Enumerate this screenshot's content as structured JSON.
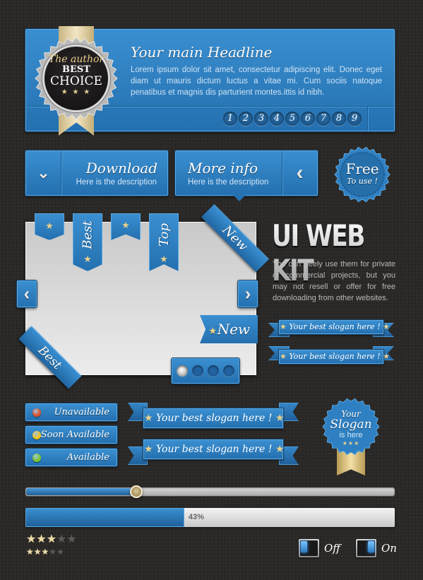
{
  "header": {
    "headline": "Your main Headline",
    "body": "Lorem ipsum dolor sit amet, consectetur adipiscing elit. Donec eget diam ut mauris dictum luctus a vitae mi. Cum sociis natoque penatibus et magnis dis parturient montes.ittis id nibh.",
    "pages": [
      "1",
      "2",
      "3",
      "4",
      "5",
      "6",
      "7",
      "8",
      "9"
    ]
  },
  "award_badge": {
    "line1": "The author",
    "line2": "BEST",
    "line3": "CHOICE",
    "stars": "★ ★ ★"
  },
  "buttons": {
    "download": {
      "title": "Download",
      "description": "Here is the description",
      "icon": "chevron-down-icon"
    },
    "more_info": {
      "title": "More info",
      "description": "Here is the description",
      "icon": "chevron-left-icon"
    }
  },
  "free_badge": {
    "title": "Free",
    "subtitle": "To use !"
  },
  "gallery": {
    "bookmarks": [
      {
        "type": "star",
        "star": "★"
      },
      {
        "type": "label",
        "label": "Best",
        "star": "★"
      },
      {
        "type": "star",
        "star": "★"
      },
      {
        "type": "label",
        "label": "Top",
        "star": "★"
      }
    ],
    "corner_top_right": "New",
    "corner_bottom_left": "Best",
    "flag": {
      "star": "★",
      "label": "New"
    },
    "prev_icon": "‹",
    "next_icon": "›",
    "dots_total": 4,
    "dots_active": 1
  },
  "kit": {
    "title": "UI WEB KIT",
    "description": "You can freely use them for private or commercial projects, but you may not resell or offer for free downloading from other websites."
  },
  "slogans": {
    "small_1": "Your best slogan here !",
    "small_2": "Your best slogan here !",
    "large_1": "Your best slogan here !",
    "large_2": "Your best slogan here !",
    "star": "★"
  },
  "status_items": [
    {
      "label": "Unavailable",
      "color": "#e0522a"
    },
    {
      "label": "Soon Available",
      "color": "#f2c21a"
    },
    {
      "label": "Available",
      "color": "#7cc62a"
    }
  ],
  "slogan_badge": {
    "line1": "Your",
    "line2": "Slogan",
    "line3": "is here",
    "stars": "★★★"
  },
  "slider": {
    "value_percent": 30
  },
  "progress": {
    "value_percent": 43,
    "label": "43%"
  },
  "ratings": {
    "large": {
      "value": 3,
      "max": 5
    },
    "small": {
      "value": 3,
      "max": 5
    }
  },
  "toggles": [
    {
      "label": "Off",
      "state": "off"
    },
    {
      "label": "On",
      "state": "on"
    }
  ],
  "colors": {
    "accent_blue": "#2f80c2",
    "gold": "#e8d08c",
    "background": "#2a2826"
  }
}
